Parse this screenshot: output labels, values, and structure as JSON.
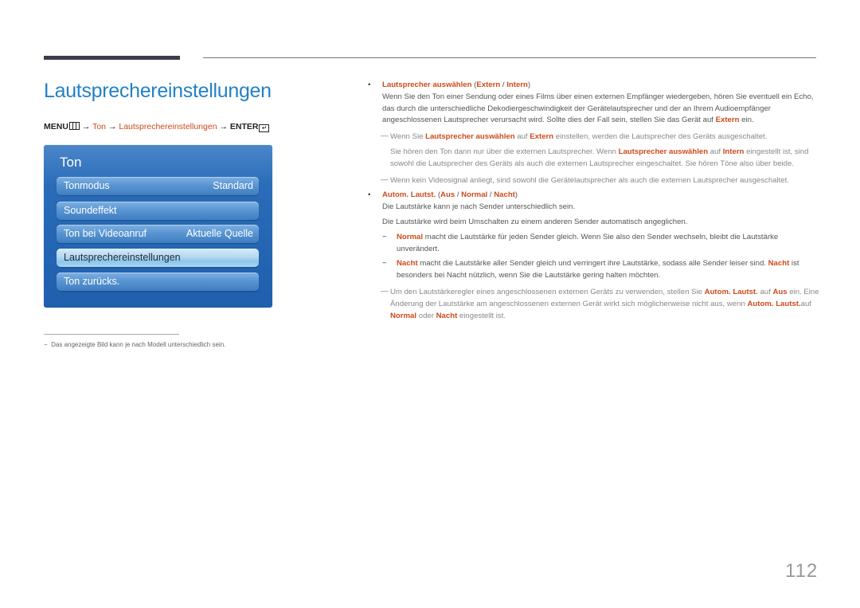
{
  "page": {
    "title": "Lautsprechereinstellungen",
    "page_number": "112"
  },
  "menu_path": {
    "menu": "MENU",
    "menu_icon": "menu-icon",
    "arrow": "→",
    "ton": "Ton",
    "target": "Lautsprechereinstellungen",
    "enter": "ENTER",
    "enter_icon": "enter-icon"
  },
  "osd": {
    "title": "Ton",
    "items": [
      {
        "label": "Tonmodus",
        "value": "Standard",
        "selected": false
      },
      {
        "label": "Soundeffekt",
        "value": "",
        "selected": false
      },
      {
        "label": "Ton bei Videoanruf",
        "value": "Aktuelle Quelle",
        "selected": false
      },
      {
        "label": "Lautsprechereinstellungen",
        "value": "",
        "selected": true
      },
      {
        "label": "Ton zurücks.",
        "value": "",
        "selected": false
      }
    ]
  },
  "footnote": {
    "mark": "−",
    "text": "Das angezeigte Bild kann je nach Modell unterschiedlich sein."
  },
  "section1": {
    "bullet": "•",
    "head_term": "Lautsprecher auswählen",
    "head_open": " (",
    "opt1": "Extern",
    "sep": " / ",
    "opt2": "Intern",
    "head_close": ")",
    "para_a": "Wenn Sie den Ton einer Sendung oder eines Films über einen externen Empfänger wiedergeben, hören Sie eventuell ein Echo, das durch die unterschiedliche Dekodiergeschwindigkeit der Gerätelautsprecher und der an Ihrem Audioempfänger angeschlossenen Lautsprecher verursacht wird. Sollte dies der Fall sein, stellen Sie das Gerät auf ",
    "para_hl": "Extern",
    "para_b": " ein.",
    "note1": {
      "mark": "—",
      "t1": "Wenn Sie ",
      "h1": "Lautsprecher auswählen",
      "t2": " auf ",
      "h2": "Extern",
      "t3": " einstellen, werden die Lautsprecher des Geräts ausgeschaltet."
    },
    "note1b": {
      "t1": "Sie hören den Ton dann nur über die externen Lautsprecher. Wenn ",
      "h1": "Lautsprecher auswählen",
      "t2": " auf ",
      "h2": "Intern",
      "t3": " eingestellt ist, sind sowohl die Lautsprecher des Geräts als auch die externen Lautsprecher eingeschaltet. Sie hören Töne also über beide."
    },
    "note2": {
      "mark": "—",
      "text": "Wenn kein Videosignal anliegt, sind sowohl die Gerätelautsprecher als auch die externen Lautsprecher ausgeschaltet."
    }
  },
  "section2": {
    "bullet": "•",
    "head_term": "Autom. Lautst.",
    "head_open": " (",
    "opt1": "Aus",
    "sep": " / ",
    "opt2": "Normal",
    "opt3": "Nacht",
    "head_close": ")",
    "para1": "Die Lautstärke kann je nach Sender unterschiedlich sein.",
    "para2": "Die Lautstärke wird beim Umschalten zu einem anderen Sender automatisch angeglichen.",
    "sub1": {
      "dash": "−",
      "term": "Normal",
      "text": " macht die Lautstärke für jeden Sender gleich. Wenn Sie also den Sender wechseln, bleibt die Lautstärke unverändert."
    },
    "sub2": {
      "dash": "−",
      "term": "Nacht",
      "text": " macht die Lautstärke aller Sender gleich und verringert ihre Lautstärke, sodass alle Sender leiser sind. ",
      "term2": "Nacht",
      "text2": " ist besonders bei Nacht nützlich, wenn Sie die Lautstärke gering halten möchten."
    },
    "note": {
      "mark": "—",
      "t1": "Um den Lautstärkeregler eines angeschlossenen externen Geräts zu verwenden, stellen Sie ",
      "h1": "Autom. Lautst.",
      "t2": " auf ",
      "h2": "Aus",
      "t3": " ein. Eine Änderung der Lautstärke am angeschlossenen externen Gerät wirkt sich möglicherweise nicht aus, wenn ",
      "h3": "Autom. Lautst.",
      "t4": "auf ",
      "h4": "Normal",
      "t5": " oder ",
      "h5": "Nacht",
      "t6": " eingestellt ist."
    }
  },
  "colors": {
    "title_blue": "#2481c5",
    "highlight_orange": "#cd4a1a",
    "osd_blue": "#1f5fae"
  }
}
